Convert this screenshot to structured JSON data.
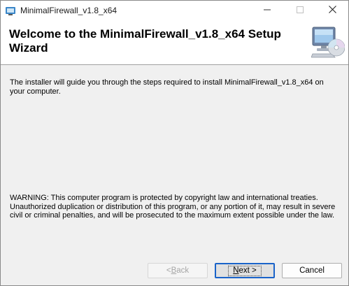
{
  "window": {
    "title": "MinimalFirewall_v1.8_x64",
    "icons": {
      "app": "installer-icon",
      "minimize": "minimize-icon",
      "maximize": "maximize-icon",
      "close": "close-icon"
    }
  },
  "header": {
    "title": "Welcome to the MinimalFirewall_v1.8_x64 Setup Wizard",
    "graphic": "computer-cd-icon"
  },
  "body": {
    "intro": "The installer will guide you through the steps required to install MinimalFirewall_v1.8_x64 on your computer.",
    "warning": "WARNING: This computer program is protected by copyright law and international treaties. Unauthorized duplication or distribution of this program, or any portion of it, may result in severe civil or criminal penalties, and will be prosecuted to the maximum extent possible under the law."
  },
  "buttons": {
    "back_prefix": "< ",
    "back_mnemonic": "B",
    "back_rest": "ack",
    "back_enabled": false,
    "next_mnemonic": "N",
    "next_rest": "ext >",
    "cancel_label": "Cancel"
  },
  "colors": {
    "focus_border": "#1a63c9",
    "disabled_text": "#a6a6a6"
  }
}
